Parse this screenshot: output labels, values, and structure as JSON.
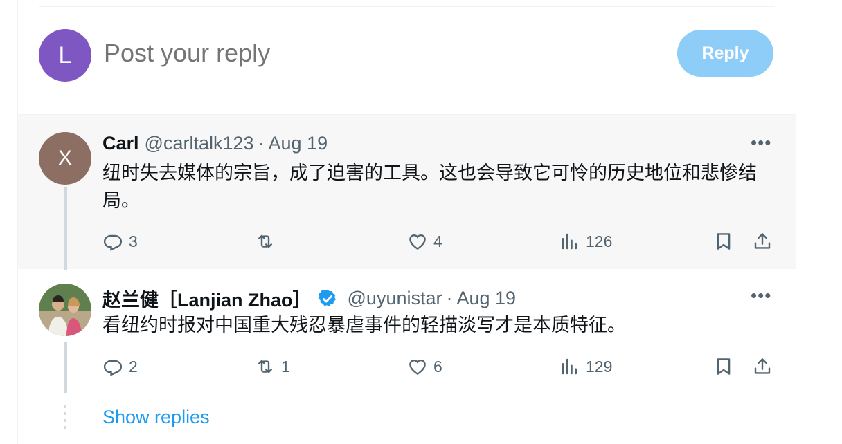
{
  "composer": {
    "avatar_letter": "L",
    "avatar_color": "#7e57c2",
    "placeholder": "Post your reply",
    "reply_label": "Reply"
  },
  "tweets": [
    {
      "avatar_letter": "X",
      "avatar_color": "#8d6e63",
      "name": "Carl",
      "handle": "@carltalk123",
      "separator": "·",
      "date": "Aug 19",
      "verified": false,
      "text": "纽时失去媒体的宗旨，成了迫害的工具。这也会导致它可怜的历史地位和悲惨结局。",
      "replies": "3",
      "reposts": "",
      "likes": "4",
      "views": "126"
    },
    {
      "name": "赵兰健［Lanjian Zhao］",
      "handle": "@uyunistar",
      "separator": "·",
      "date": "Aug 19",
      "verified": true,
      "text": "看纽约时报对中国重大残忍暴虐事件的轻描淡写才是本质特征。",
      "replies": "2",
      "reposts": "1",
      "likes": "6",
      "views": "129"
    }
  ],
  "show_replies_label": "Show replies",
  "colors": {
    "accent": "#1d9bf0",
    "reply_button_disabled": "#8ecdf8",
    "muted_text": "#536471",
    "highlight_background": "#f7f7f7"
  },
  "icons": [
    "reply-icon",
    "repost-icon",
    "like-icon",
    "views-icon",
    "bookmark-icon",
    "share-icon",
    "more-icon",
    "verified-badge-icon"
  ]
}
